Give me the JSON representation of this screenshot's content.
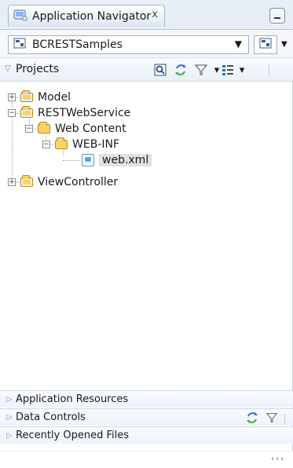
{
  "tab": {
    "title": "Application Navigator",
    "close": "x",
    "minimize": "–"
  },
  "app_selector": {
    "value": "BCRESTSamples"
  },
  "projects": {
    "label": "Projects",
    "tools": [
      "filter-icon",
      "sync-icon",
      "funnel-icon",
      "layout-icon"
    ]
  },
  "tree": [
    {
      "label": "Model",
      "level": 0,
      "type": "project",
      "expander": "+"
    },
    {
      "label": "RESTWebService",
      "level": 0,
      "type": "project",
      "expander": "−"
    },
    {
      "label": "Web Content",
      "level": 1,
      "type": "folder",
      "expander": "−"
    },
    {
      "label": "WEB-INF",
      "level": 2,
      "type": "folder",
      "expander": "−"
    },
    {
      "label": "web.xml",
      "level": 3,
      "type": "file",
      "selected": true
    },
    {
      "label": "ViewController",
      "level": 0,
      "type": "project",
      "expander": "+"
    }
  ],
  "accordions": [
    {
      "label": "Application Resources"
    },
    {
      "label": "Data Controls"
    },
    {
      "label": "Recently Opened Files"
    }
  ],
  "status": {
    "right": "‹‹‹"
  },
  "colors": {
    "folder": "#f6d36b",
    "selection": "#e2e2e2",
    "tabbar": "#e8eef5"
  }
}
